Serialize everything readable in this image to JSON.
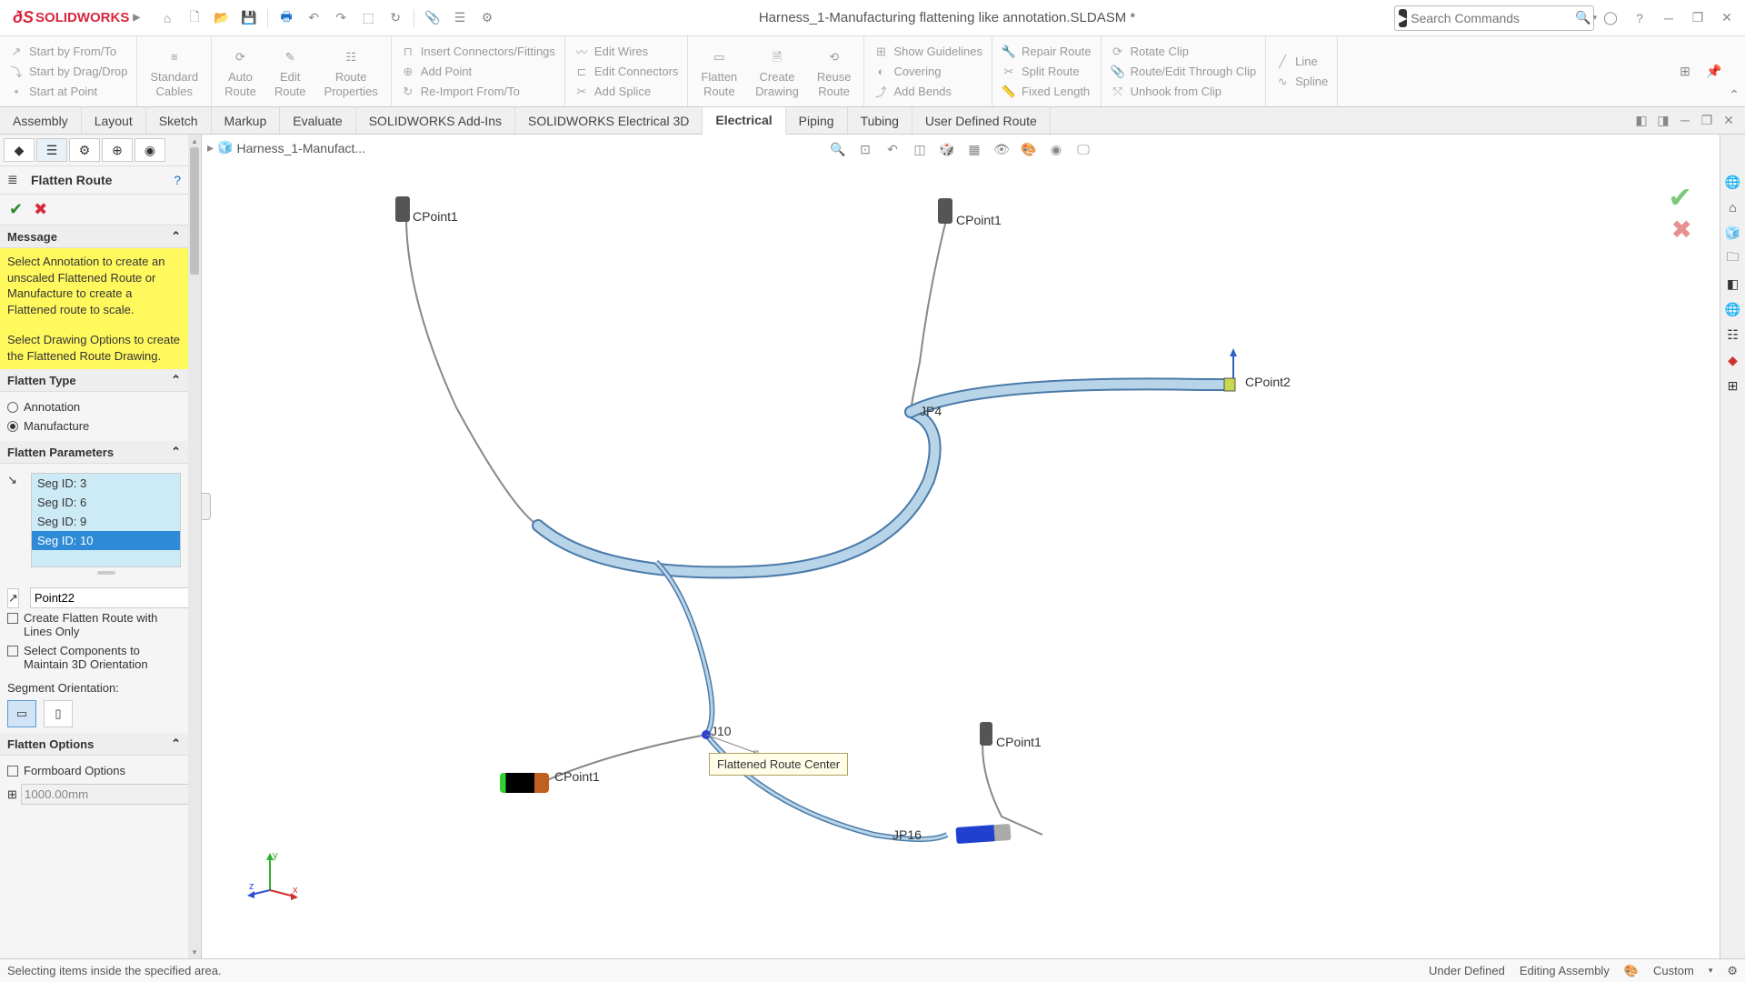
{
  "app": {
    "name": "SOLIDWORKS",
    "title": "Harness_1-Manufacturing flattening like annotation.SLDASM *"
  },
  "search": {
    "placeholder": "Search Commands"
  },
  "ribbon": {
    "g1": [
      "Start by From/To",
      "Start by Drag/Drop",
      "Start at Point"
    ],
    "g2": [
      "Standard",
      "Cables"
    ],
    "g3a": [
      "Auto",
      "Route"
    ],
    "g3b": [
      "Edit",
      "Route"
    ],
    "g3c": [
      "Route",
      "Properties"
    ],
    "g4": [
      "Insert Connectors/Fittings",
      "Add Point",
      "Re-Import From/To"
    ],
    "g5": [
      "Edit Wires",
      "Edit Connectors",
      "Add Splice"
    ],
    "g6a": [
      "Flatten",
      "Route"
    ],
    "g6b": [
      "Create",
      "Drawing"
    ],
    "g6c": [
      "Reuse",
      "Route"
    ],
    "g7": [
      "Show Guidelines",
      "Covering",
      "Add Bends"
    ],
    "g8": [
      "Repair Route",
      "Split Route",
      "Fixed Length"
    ],
    "g9": [
      "Rotate Clip",
      "Route/Edit Through Clip",
      "Unhook from Clip"
    ],
    "g10": [
      "Line",
      "Spline"
    ]
  },
  "tabs": [
    "Assembly",
    "Layout",
    "Sketch",
    "Markup",
    "Evaluate",
    "SOLIDWORKS Add-Ins",
    "SOLIDWORKS Electrical 3D",
    "Electrical",
    "Piping",
    "Tubing",
    "User Defined Route"
  ],
  "active_tab": "Electrical",
  "breadcrumb": "Harness_1-Manufact...",
  "panel": {
    "title": "Flatten Route",
    "sections": {
      "message": "Message",
      "msg_text1": "Select Annotation to create an unscaled Flattened Route or Manufacture to create a Flattened route to scale.",
      "msg_text2": "Select Drawing Options to create the Flattened Route Drawing.",
      "flatten_type": "Flatten Type",
      "annotation": "Annotation",
      "manufacture": "Manufacture",
      "flatten_params": "Flatten Parameters",
      "segs": [
        "Seg ID: 3",
        "Seg ID: 6",
        "Seg ID: 9",
        "Seg ID: 10"
      ],
      "seg_selected": 3,
      "point_input": "Point22",
      "cb1": "Create Flatten Route with Lines Only",
      "cb2": "Select Components to Maintain 3D Orientation",
      "seg_orient": "Segment Orientation:",
      "flatten_opts": "Flatten Options",
      "formboard": "Formboard Options",
      "dim": "1000.00mm"
    }
  },
  "canvas": {
    "tooltip": "Flattened Route Center",
    "labels": {
      "cp1": "CPoint1",
      "cp2": "CPoint1",
      "cp3": "CPoint2",
      "cp4": "CPoint1",
      "cp5": "CPoint1",
      "jp4": "JP4",
      "j10": "J10",
      "jp16": "JP16"
    },
    "axes": {
      "x": "x",
      "y": "y",
      "z": "z"
    }
  },
  "status": {
    "left": "Selecting items inside the specified area.",
    "r1": "Under Defined",
    "r2": "Editing Assembly",
    "r3": "Custom"
  }
}
